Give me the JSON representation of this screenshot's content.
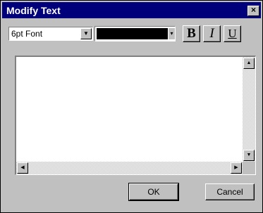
{
  "window": {
    "title": "Modify Text",
    "close_glyph": "×"
  },
  "toolbar": {
    "font_size_value": "6pt Font",
    "font_dropdown_glyph": "▼",
    "color_value": "#000000",
    "color_dropdown_glyph": "▾",
    "bold_label": "B",
    "italic_label": "I",
    "underline_label": "U"
  },
  "editor": {
    "text": "",
    "scroll_up_glyph": "▲",
    "scroll_down_glyph": "▼",
    "scroll_left_glyph": "◀",
    "scroll_right_glyph": "▶"
  },
  "buttons": {
    "ok_label": "OK",
    "cancel_label": "Cancel"
  },
  "colors": {
    "titlebar": "#00007b",
    "face": "#c0c0c0",
    "text_color": "#000000"
  }
}
